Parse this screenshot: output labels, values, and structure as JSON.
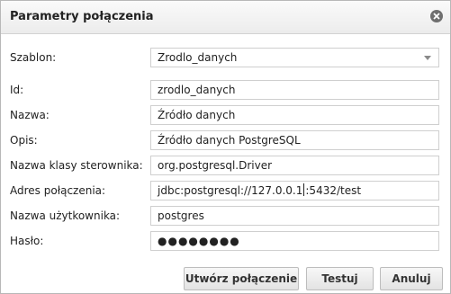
{
  "dialog": {
    "title": "Parametry połączenia",
    "close_icon": "close-circle-icon"
  },
  "form": {
    "template": {
      "label": "Szablon:",
      "value": "Zrodlo_danych"
    },
    "id": {
      "label": "Id:",
      "value": "zrodlo_danych"
    },
    "name": {
      "label": "Nazwa:",
      "value": "Źródło danych"
    },
    "description": {
      "label": "Opis:",
      "value": "Źródło danych PostgreSQL"
    },
    "driver": {
      "label": "Nazwa klasy sterownika:",
      "value": "org.postgresql.Driver"
    },
    "url": {
      "label": "Adres połączenia:",
      "value_before_cursor": "jdbc:postgresql://127.0.0.1",
      "value_after_cursor": ":5432/test"
    },
    "username": {
      "label": "Nazwa użytkownika:",
      "value": "postgres"
    },
    "password": {
      "label": "Hasło:",
      "masked_value": "●●●●●●●●"
    }
  },
  "buttons": {
    "create_label": "Utwórz połączenie",
    "test_label": "Testuj",
    "cancel_label": "Anuluj"
  }
}
